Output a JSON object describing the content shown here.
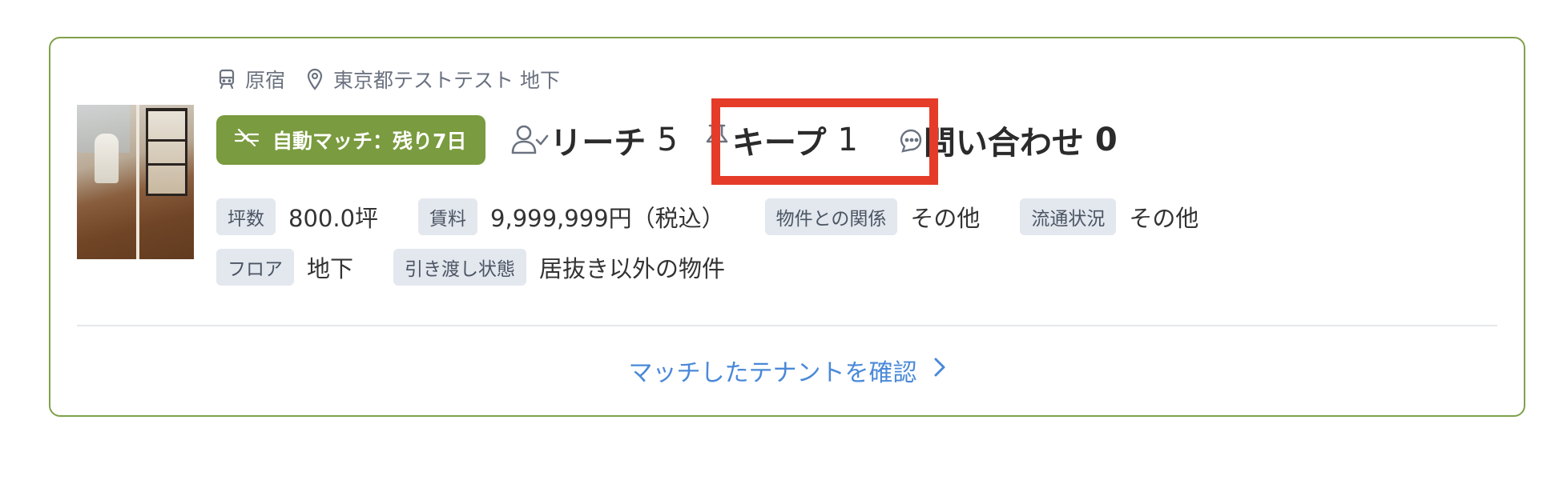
{
  "location": {
    "station": "原宿",
    "address": "東京都テストテスト 地下",
    "station_icon": "train-icon",
    "address_icon": "map-pin-icon"
  },
  "badge": {
    "label": "自動マッチ：残り7日",
    "icon": "match-off-icon",
    "color": "#7a9b3f"
  },
  "stats": {
    "reach": {
      "label": "リーチ",
      "value": "5",
      "icon": "user-check-icon"
    },
    "keep": {
      "label": "キープ",
      "value": "1",
      "icon": "pin-icon"
    },
    "inquiry": {
      "label": "問い合わせ",
      "value": "0",
      "icon": "chat-icon"
    }
  },
  "properties": {
    "row1": [
      {
        "tag": "坪数",
        "value": "800.0坪"
      },
      {
        "tag": "賃料",
        "value": "9,999,999円（税込）"
      },
      {
        "tag": "物件との関係",
        "value": "その他"
      },
      {
        "tag": "流通状況",
        "value": "その他"
      }
    ],
    "row2": [
      {
        "tag": "フロア",
        "value": "地下"
      },
      {
        "tag": "引き渡し状態",
        "value": "居抜き以外の物件"
      }
    ]
  },
  "cta": {
    "label": "マッチしたテナントを確認",
    "icon": "chevron-right-icon"
  },
  "colors": {
    "border": "#7fa14a",
    "highlight": "#e53b29",
    "link": "#4a89d8"
  }
}
